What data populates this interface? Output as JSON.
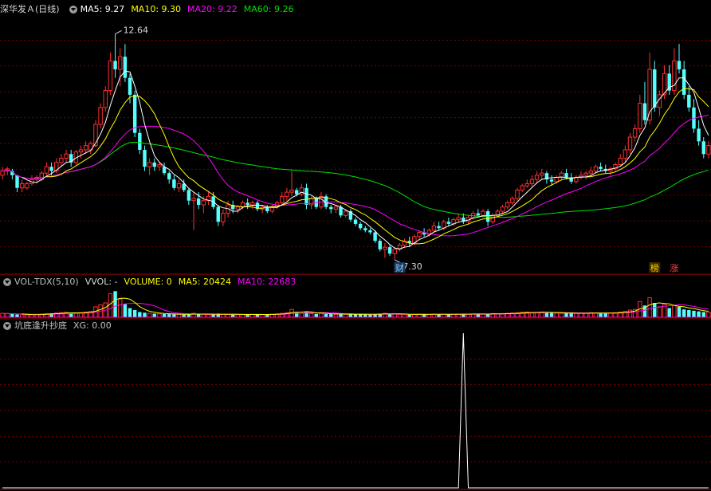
{
  "header": {
    "stock_title": "深华发Ａ(日线)",
    "ma5": "MA5: 9.27",
    "ma10": "MA10: 9.30",
    "ma20": "MA20: 9.22",
    "ma60": "MA60: 9.26"
  },
  "volume_header": {
    "indicator": "VOL-TDX(5,10)",
    "vvol": "VVOL: -",
    "volume": "VOLUME: 0",
    "ma5": "MA5: 20424",
    "ma10": "MA10: 22683"
  },
  "xg_header": {
    "indicator": "坑底逢升抄底",
    "xg": "XG: 0.00"
  },
  "colors": {
    "background": "#000000",
    "up": "#ff3030",
    "down": "#54ffff",
    "ma5": "#ffffff",
    "ma10": "#ffff00",
    "ma20": "#ff00ff",
    "ma60": "#00e000",
    "grid": "#7a0000",
    "text": "#d8d8d8"
  },
  "chart_data": [
    {
      "type": "candlestick",
      "annotations": {
        "high_label": "12.64",
        "low_label": "7.30",
        "marker_cai": "财",
        "marker_bang": "榜",
        "marker_zhang": "涨"
      },
      "price_range": [
        7.0,
        13.1
      ],
      "high_value": 12.64,
      "high_index": 23,
      "low_value": 7.3,
      "low_index": 80,
      "cai_index": 81,
      "bang_index": 133,
      "zhang_index": 137,
      "candles": [
        [
          9.3,
          9.5,
          9.2,
          9.4
        ],
        [
          9.4,
          9.5,
          9.3,
          9.45
        ],
        [
          9.4,
          9.45,
          9.2,
          9.3
        ],
        [
          9.3,
          9.3,
          8.9,
          9.0
        ],
        [
          9.0,
          9.2,
          8.9,
          9.1
        ],
        [
          9.0,
          9.15,
          8.95,
          9.1
        ],
        [
          9.1,
          9.3,
          9.05,
          9.2
        ],
        [
          9.2,
          9.3,
          9.1,
          9.25
        ],
        [
          9.2,
          9.4,
          9.15,
          9.35
        ],
        [
          9.35,
          9.6,
          9.3,
          9.5
        ],
        [
          9.5,
          9.6,
          9.3,
          9.4
        ],
        [
          9.4,
          9.7,
          9.35,
          9.6
        ],
        [
          9.6,
          9.8,
          9.5,
          9.7
        ],
        [
          9.7,
          9.9,
          9.6,
          9.8
        ],
        [
          9.8,
          9.9,
          9.5,
          9.6
        ],
        [
          9.6,
          9.9,
          9.55,
          9.85
        ],
        [
          9.85,
          10.0,
          9.7,
          9.9
        ],
        [
          9.9,
          10.1,
          9.8,
          10.0
        ],
        [
          9.9,
          10.1,
          9.8,
          10.05
        ],
        [
          10.0,
          10.6,
          9.95,
          10.5
        ],
        [
          10.5,
          11.0,
          10.4,
          10.9
        ],
        [
          10.9,
          11.4,
          10.8,
          11.3
        ],
        [
          11.3,
          12.2,
          11.2,
          12.0
        ],
        [
          12.0,
          12.64,
          11.6,
          11.8
        ],
        [
          11.8,
          12.3,
          11.4,
          12.1
        ],
        [
          12.1,
          12.4,
          11.5,
          11.6
        ],
        [
          11.6,
          11.7,
          11.0,
          11.2
        ],
        [
          11.2,
          11.3,
          10.2,
          10.3
        ],
        [
          10.3,
          10.4,
          9.8,
          9.9
        ],
        [
          9.9,
          10.0,
          9.4,
          9.5
        ],
        [
          9.5,
          9.7,
          9.3,
          9.6
        ],
        [
          9.6,
          9.7,
          9.4,
          9.5
        ],
        [
          9.5,
          9.6,
          9.4,
          9.55
        ],
        [
          9.5,
          9.6,
          9.3,
          9.35
        ],
        [
          9.35,
          9.4,
          9.1,
          9.2
        ],
        [
          9.2,
          9.3,
          8.95,
          9.0
        ],
        [
          9.0,
          9.2,
          8.9,
          9.1
        ],
        [
          9.1,
          9.2,
          8.9,
          8.95
        ],
        [
          8.95,
          9.0,
          8.6,
          8.7
        ],
        [
          8.7,
          8.9,
          8.0,
          8.75
        ],
        [
          8.75,
          8.9,
          8.5,
          8.6
        ],
        [
          8.6,
          8.8,
          8.4,
          8.7
        ],
        [
          8.7,
          8.9,
          8.6,
          8.8
        ],
        [
          8.8,
          8.9,
          8.5,
          8.55
        ],
        [
          8.55,
          8.6,
          8.1,
          8.2
        ],
        [
          8.2,
          8.5,
          8.1,
          8.4
        ],
        [
          8.4,
          8.7,
          8.3,
          8.6
        ],
        [
          8.6,
          8.7,
          8.4,
          8.5
        ],
        [
          8.5,
          8.6,
          8.4,
          8.55
        ],
        [
          8.55,
          8.7,
          8.5,
          8.65
        ],
        [
          8.65,
          8.75,
          8.5,
          8.6
        ],
        [
          8.6,
          8.7,
          8.5,
          8.65
        ],
        [
          8.65,
          8.7,
          8.45,
          8.5
        ],
        [
          8.5,
          8.6,
          8.4,
          8.55
        ],
        [
          8.55,
          8.6,
          8.4,
          8.45
        ],
        [
          8.45,
          8.6,
          8.4,
          8.55
        ],
        [
          8.55,
          8.7,
          8.5,
          8.65
        ],
        [
          8.65,
          8.9,
          8.6,
          8.8
        ],
        [
          8.8,
          9.0,
          8.7,
          8.9
        ],
        [
          8.9,
          9.4,
          8.8,
          8.95
        ],
        [
          8.95,
          9.0,
          8.8,
          8.85
        ],
        [
          8.85,
          9.1,
          8.8,
          9.0
        ],
        [
          9.0,
          9.1,
          8.5,
          8.6
        ],
        [
          8.6,
          8.8,
          8.5,
          8.75
        ],
        [
          8.75,
          8.8,
          8.5,
          8.55
        ],
        [
          8.55,
          8.9,
          8.5,
          8.8
        ],
        [
          8.8,
          8.85,
          8.5,
          8.55
        ],
        [
          8.55,
          8.6,
          8.4,
          8.5
        ],
        [
          8.5,
          8.6,
          8.4,
          8.55
        ],
        [
          8.55,
          8.6,
          8.3,
          8.35
        ],
        [
          8.35,
          8.5,
          8.3,
          8.45
        ],
        [
          8.45,
          8.5,
          8.2,
          8.25
        ],
        [
          8.25,
          8.3,
          8.1,
          8.15
        ],
        [
          8.15,
          8.2,
          8.0,
          8.05
        ],
        [
          8.05,
          8.1,
          7.95,
          8.0
        ],
        [
          8.0,
          8.05,
          7.9,
          7.95
        ],
        [
          7.95,
          8.0,
          7.7,
          7.75
        ],
        [
          7.75,
          7.8,
          7.5,
          7.55
        ],
        [
          7.55,
          7.7,
          7.35,
          7.6
        ],
        [
          7.6,
          7.65,
          7.4,
          7.45
        ],
        [
          7.45,
          7.6,
          7.3,
          7.55
        ],
        [
          7.55,
          7.7,
          7.5,
          7.65
        ],
        [
          7.65,
          7.8,
          7.6,
          7.75
        ],
        [
          7.75,
          7.85,
          7.6,
          7.7
        ],
        [
          7.7,
          7.9,
          7.65,
          7.85
        ],
        [
          7.85,
          8.0,
          7.8,
          7.95
        ],
        [
          7.95,
          8.05,
          7.85,
          7.9
        ],
        [
          7.9,
          8.05,
          7.85,
          8.0
        ],
        [
          8.0,
          8.2,
          7.95,
          8.1
        ],
        [
          8.1,
          8.2,
          8.0,
          8.05
        ],
        [
          8.05,
          8.25,
          8.0,
          8.2
        ],
        [
          8.2,
          8.3,
          8.1,
          8.15
        ],
        [
          8.15,
          8.3,
          8.1,
          8.25
        ],
        [
          8.25,
          8.4,
          8.2,
          8.3
        ],
        [
          8.3,
          8.4,
          8.15,
          8.2
        ],
        [
          8.2,
          8.35,
          8.15,
          8.3
        ],
        [
          8.3,
          8.45,
          8.25,
          8.4
        ],
        [
          8.4,
          8.5,
          8.3,
          8.35
        ],
        [
          8.35,
          8.5,
          8.3,
          8.45
        ],
        [
          8.45,
          8.5,
          8.1,
          8.2
        ],
        [
          8.2,
          8.4,
          8.15,
          8.35
        ],
        [
          8.35,
          8.5,
          8.3,
          8.45
        ],
        [
          8.45,
          8.6,
          8.4,
          8.55
        ],
        [
          8.55,
          8.7,
          8.5,
          8.65
        ],
        [
          8.65,
          8.8,
          8.6,
          8.75
        ],
        [
          8.75,
          9.0,
          8.7,
          8.95
        ],
        [
          8.95,
          9.1,
          8.9,
          9.05
        ],
        [
          9.05,
          9.2,
          9.0,
          9.1
        ],
        [
          9.1,
          9.3,
          9.0,
          9.2
        ],
        [
          9.2,
          9.4,
          9.1,
          9.3
        ],
        [
          9.3,
          9.45,
          9.2,
          9.35
        ],
        [
          9.35,
          9.4,
          9.1,
          9.2
        ],
        [
          9.2,
          9.3,
          9.05,
          9.15
        ],
        [
          9.15,
          9.3,
          9.1,
          9.25
        ],
        [
          9.25,
          9.4,
          9.2,
          9.35
        ],
        [
          9.35,
          9.45,
          9.2,
          9.25
        ],
        [
          9.25,
          9.35,
          9.1,
          9.15
        ],
        [
          9.15,
          9.3,
          9.1,
          9.25
        ],
        [
          9.25,
          9.4,
          9.2,
          9.3
        ],
        [
          9.3,
          9.4,
          9.2,
          9.35
        ],
        [
          9.35,
          9.5,
          9.3,
          9.4
        ],
        [
          9.4,
          9.55,
          9.35,
          9.5
        ],
        [
          9.5,
          9.6,
          9.4,
          9.45
        ],
        [
          9.45,
          9.55,
          9.35,
          9.4
        ],
        [
          9.4,
          9.5,
          9.3,
          9.45
        ],
        [
          9.45,
          9.6,
          9.4,
          9.55
        ],
        [
          9.55,
          9.8,
          9.5,
          9.7
        ],
        [
          9.7,
          10.0,
          9.6,
          9.9
        ],
        [
          9.9,
          10.3,
          9.8,
          10.2
        ],
        [
          10.2,
          10.5,
          10.1,
          10.4
        ],
        [
          10.4,
          11.2,
          10.3,
          11.0
        ],
        [
          11.0,
          11.5,
          10.5,
          10.6
        ],
        [
          10.6,
          12.2,
          10.5,
          11.8
        ],
        [
          11.8,
          12.0,
          10.8,
          10.9
        ],
        [
          10.9,
          11.3,
          10.7,
          11.2
        ],
        [
          11.2,
          11.9,
          11.1,
          11.7
        ],
        [
          11.7,
          11.9,
          11.2,
          11.3
        ],
        [
          11.3,
          12.3,
          11.2,
          12.0
        ],
        [
          12.0,
          12.4,
          11.7,
          11.8
        ],
        [
          11.8,
          12.0,
          11.1,
          11.2
        ],
        [
          11.2,
          11.4,
          10.8,
          10.9
        ],
        [
          10.9,
          11.1,
          10.3,
          10.4
        ],
        [
          10.4,
          10.6,
          10.0,
          10.1
        ],
        [
          10.1,
          10.2,
          9.7,
          9.8
        ],
        [
          9.8,
          10.1,
          9.7,
          10.0
        ]
      ],
      "volume_values": [
        30,
        28,
        25,
        22,
        20,
        18,
        20,
        22,
        25,
        28,
        30,
        32,
        35,
        38,
        32,
        30,
        35,
        40,
        45,
        80,
        95,
        110,
        180,
        200,
        140,
        100,
        70,
        55,
        40,
        35,
        30,
        28,
        26,
        25,
        24,
        22,
        22,
        20,
        25,
        30,
        24,
        22,
        20,
        22,
        28,
        24,
        22,
        20,
        20,
        22,
        24,
        22,
        20,
        20,
        22,
        24,
        26,
        30,
        35,
        60,
        40,
        30,
        45,
        28,
        26,
        30,
        25,
        24,
        22,
        25,
        24,
        24,
        22,
        24,
        22,
        20,
        24,
        28,
        30,
        26,
        24,
        22,
        22,
        20,
        22,
        24,
        22,
        22,
        24,
        22,
        24,
        22,
        22,
        24,
        26,
        24,
        25,
        26,
        24,
        24,
        28,
        26,
        28,
        30,
        32,
        35,
        38,
        40,
        36,
        35,
        40,
        38,
        34,
        32,
        30,
        32,
        30,
        30,
        32,
        30,
        35,
        34,
        32,
        30,
        32,
        35,
        40,
        45,
        55,
        60,
        120,
        90,
        150,
        110,
        80,
        100,
        70,
        90,
        80,
        60,
        55,
        50,
        45,
        40,
        38
      ],
      "volume_range": [
        0,
        220
      ],
      "xg_values": [
        0,
        0,
        0,
        0,
        0,
        0,
        0,
        0,
        0,
        0,
        0,
        0,
        0,
        0,
        0,
        0,
        0,
        0,
        0,
        0,
        0,
        0,
        0,
        0,
        0,
        0,
        0,
        0,
        0,
        0,
        0,
        0,
        0,
        0,
        0,
        0,
        0,
        0,
        0,
        0,
        0,
        0,
        0,
        0,
        0,
        0,
        0,
        0,
        0,
        0,
        0,
        0,
        0,
        0,
        0,
        0,
        0,
        0,
        0,
        0,
        0,
        0,
        0,
        0,
        0,
        0,
        0,
        0,
        0,
        0,
        0,
        0,
        0,
        0,
        0,
        0,
        0,
        0,
        0,
        0,
        0,
        0,
        0,
        0,
        0,
        0,
        0,
        0,
        0,
        0,
        0,
        0,
        0,
        0,
        0,
        0,
        0,
        0,
        0,
        0,
        0,
        0,
        0,
        0,
        0,
        0,
        0,
        0,
        0,
        0,
        0,
        0,
        0,
        0,
        0,
        0,
        0,
        0,
        0,
        0,
        0,
        0,
        0,
        0,
        0,
        0,
        0,
        0,
        0,
        0,
        0,
        0,
        0,
        0,
        0,
        0,
        0,
        0,
        0,
        0,
        0,
        0,
        0,
        0,
        0
      ],
      "xg_peak_index": 94,
      "xg_range": [
        0,
        1
      ]
    }
  ]
}
